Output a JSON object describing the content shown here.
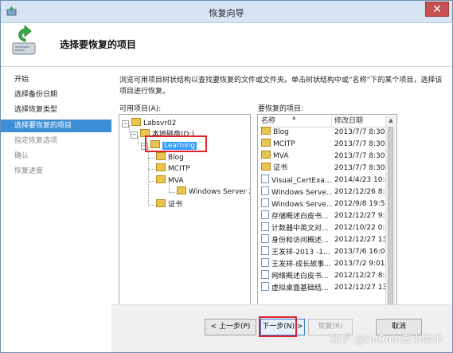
{
  "window": {
    "title": "恢复向导",
    "close_label": "✕"
  },
  "header": {
    "title": "选择要恢复的项目"
  },
  "nav": {
    "items": [
      {
        "label": "开始",
        "state": "normal"
      },
      {
        "label": "选择备份日期",
        "state": "normal"
      },
      {
        "label": "选择恢复类型",
        "state": "normal"
      },
      {
        "label": "选择要恢复的项目",
        "state": "current"
      },
      {
        "label": "指定恢复选项",
        "state": "disabled"
      },
      {
        "label": "确认",
        "state": "disabled"
      },
      {
        "label": "恢复进度",
        "state": "disabled"
      }
    ]
  },
  "content": {
    "description": "浏览可用项目树状结构以查找要恢复的文件或文件夹。单击树状结构中或“名称”下的某个项目，选择该项目进行恢复。",
    "available_label": "可用项目(A):",
    "selected_label": "要恢复的项目:"
  },
  "tree": {
    "server": "Labsvr02",
    "disk": "本地磁盘(D:)",
    "learning": "Learning",
    "blog": "Blog",
    "mcitp": "MCITP",
    "mva": "MVA",
    "windows_server": "Windows Server 2",
    "cert": "证书"
  },
  "list": {
    "columns": [
      "名称",
      "修改日期"
    ],
    "rows": [
      {
        "name": "Blog",
        "date": "2013/7/7 8:30",
        "type": "folder"
      },
      {
        "name": "MCITP",
        "date": "2013/7/7 8:30",
        "type": "folder"
      },
      {
        "name": "MVA",
        "date": "2013/7/7 8:30",
        "type": "folder"
      },
      {
        "name": "证书",
        "date": "2013/7/7 8:30",
        "type": "folder"
      },
      {
        "name": "Visual_CertExa...",
        "date": "2014/4/23 10:48",
        "type": "file"
      },
      {
        "name": "Windows Serve...",
        "date": "2012/12/26 8:15",
        "type": "file"
      },
      {
        "name": "Windows Serve...",
        "date": "2012/9/8 19:59",
        "type": "file"
      },
      {
        "name": "存储概述白皮书...",
        "date": "2012/12/27 9:01",
        "type": "file"
      },
      {
        "name": "计数器中英文对...",
        "date": "2012/10/22 0:01",
        "type": "file"
      },
      {
        "name": "身份和访问概述...",
        "date": "2012/12/27 13:08",
        "type": "file"
      },
      {
        "name": "王发祥-2013 -1...",
        "date": "2013/7/6 16:00",
        "type": "file"
      },
      {
        "name": "王发祥-成长故事...",
        "date": "2013/7/2 9:01",
        "type": "file"
      },
      {
        "name": "网络概述白皮书...",
        "date": "2012/12/27 8:26",
        "type": "file"
      },
      {
        "name": "虚拟桌面基础结...",
        "date": "2012/12/27 13:...",
        "type": "file"
      }
    ]
  },
  "buttons": {
    "prev": "< 上一步(P)",
    "next": "下一步(N) >",
    "restore": "恢复(R)",
    "cancel": "取消"
  },
  "watermark": "知乎 @HoRain云小助手"
}
